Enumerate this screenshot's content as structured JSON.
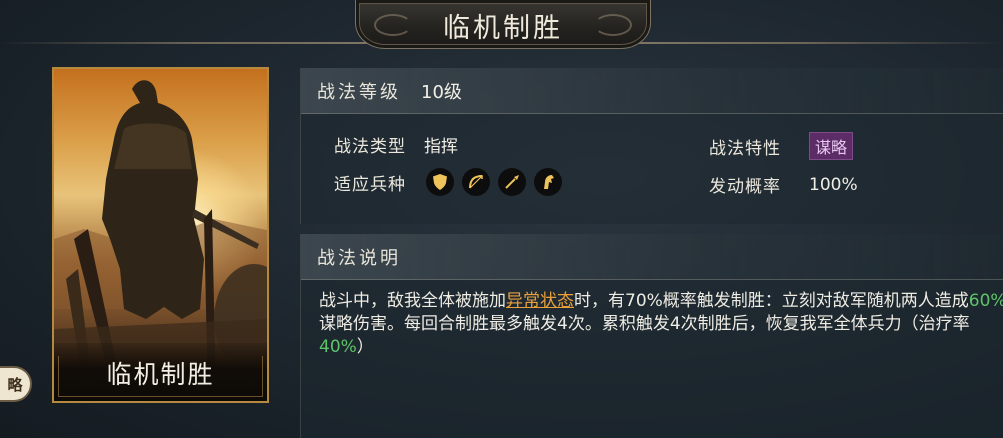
{
  "title": "临机制胜",
  "card": {
    "name": "临机制胜"
  },
  "side_button": {
    "label": "略"
  },
  "info": {
    "level_label": "战法等级",
    "level_value": "10级",
    "type_label": "战法类型",
    "type_value": "指挥",
    "feature_label": "战法特性",
    "feature_value": "谋略",
    "troops_label": "适应兵种",
    "troop_icons": [
      "shield-icon",
      "bow-icon",
      "spear-icon",
      "horse-icon"
    ],
    "chance_label": "发动概率",
    "chance_value": "100%"
  },
  "description": {
    "header": "战法说明",
    "segments": [
      {
        "text": "战斗中，敌我全体被施加",
        "style": "normal"
      },
      {
        "text": "异常状态",
        "style": "link"
      },
      {
        "text": "时，有70%概率触发制胜：立刻对敌军随机两人造成",
        "style": "normal"
      },
      {
        "text": "60%",
        "style": "green"
      },
      {
        "text": "谋略伤害。每回合制胜最多触发4次。累积触发4次制胜后，恢复我军全体兵力（治疗率",
        "style": "normal"
      },
      {
        "text": "40%",
        "style": "green"
      },
      {
        "text": "）",
        "style": "normal"
      }
    ]
  },
  "colors": {
    "link": "#e9a03a",
    "green": "#5ec46a",
    "tag_bg": "#5b2c66",
    "gold_border": "#b58a3e"
  }
}
